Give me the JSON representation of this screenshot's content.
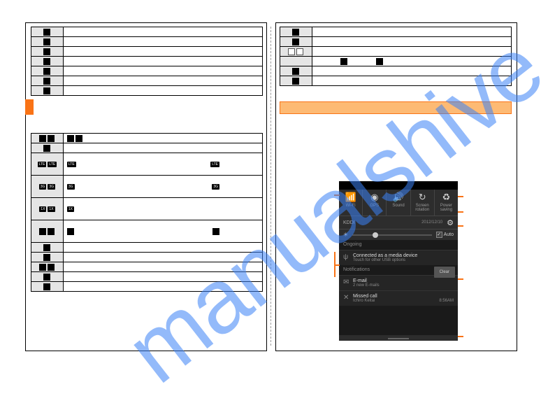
{
  "watermark": "manualshive.com",
  "icons_table1": [
    {
      "icon": "battery-bars-icon"
    },
    {
      "icon": "alarm-icon"
    },
    {
      "icon": "headphone-icon"
    },
    {
      "icon": "camera-roll-icon"
    },
    {
      "icon": "sdcard-icon"
    },
    {
      "icon": "sync-icon"
    },
    {
      "icon": "document-icon"
    }
  ],
  "icons_table2": [
    {
      "c1_icons": [
        "signal-icon",
        "no-signal-icon"
      ],
      "c2_icons": [
        "signal-mid-icon",
        "circle-icon"
      ],
      "tall": false
    },
    {
      "c1_icons": [
        "sig-small-icon"
      ],
      "c2_icons": [],
      "tall": false
    },
    {
      "c1_tags": [
        "LTE",
        "LTE"
      ],
      "c2_tag": "LTE",
      "c2_tag_right": "LTE",
      "tall": true
    },
    {
      "c1_tags": [
        "3G",
        "3G"
      ],
      "c2_tag": "3G",
      "c2_tag_right": "3G",
      "tall": true
    },
    {
      "c1_tags": [
        "1X",
        "1X"
      ],
      "c2_tag": "1X",
      "tall": true
    },
    {
      "c1_icons": [
        "wifi-icon",
        "wifi-qs-icon"
      ],
      "c2_icons": [
        "wifi-small-icon"
      ],
      "c2_icon_right": "wifi-box-icon",
      "tall": true
    },
    {
      "c1_icons": [
        "bt-icon"
      ],
      "tall": false
    },
    {
      "c1_icons": [
        "mute-icon"
      ],
      "tall": false
    },
    {
      "c1_icons": [
        "globe-icon",
        "globe2-icon"
      ],
      "tall": false
    },
    {
      "c1_icons": [
        "airplane-icon"
      ],
      "tall": false
    },
    {
      "c1_icons": [
        "location-icon"
      ],
      "tall": false
    }
  ],
  "icons_table3": [
    {
      "icon": "call-icon"
    },
    {
      "icon": "call-fwd-icon"
    },
    {
      "icon_pair": [
        "box1-icon",
        "box2-icon"
      ]
    },
    {
      "c2_icons": [
        "box-a-icon",
        "box-b-icon"
      ]
    },
    {
      "icon": "msg-icon"
    },
    {
      "icon": "share-icon"
    }
  ],
  "phone": {
    "toggles": [
      {
        "icon": "📶",
        "label": "Wi-Fi"
      },
      {
        "icon": "◉",
        "label": "GPS"
      },
      {
        "icon": "🔊",
        "label": "Sound"
      },
      {
        "icon": "↻",
        "label": "Screen rotation"
      },
      {
        "icon": "♻",
        "label": "Power saving"
      }
    ],
    "carrier": "KDDI",
    "date": "2012/12/10",
    "auto_label": "Auto",
    "ongoing_label": "Ongoing",
    "ongoing_item": {
      "title": "Connected as a media device",
      "sub": "Touch for other USB options"
    },
    "notifications_label": "Notifications",
    "clear_label": "Clear",
    "notif_items": [
      {
        "icon": "✉",
        "title": "E-mail",
        "sub": "2 new E-mails",
        "time": ""
      },
      {
        "icon": "✕",
        "title": "Missed call",
        "sub": "Ichiro Keitai",
        "time": "8:56AM"
      }
    ]
  }
}
